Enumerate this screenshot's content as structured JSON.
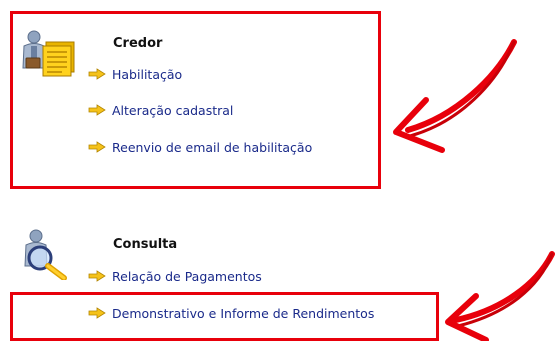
{
  "sections": [
    {
      "title": "Credor",
      "icon": "person-documents-icon",
      "links": [
        {
          "label": "Habilitação"
        },
        {
          "label": "Alteração cadastral"
        },
        {
          "label": "Reenvio de email de habilitação"
        }
      ]
    },
    {
      "title": "Consulta",
      "icon": "person-magnifier-icon",
      "links": [
        {
          "label": "Relação de Pagamentos"
        },
        {
          "label": "Demonstrativo e Informe de Rendimentos"
        }
      ]
    }
  ],
  "annotation": {
    "highlight_color": "#e8000b",
    "arrow_icon": "red-hand-drawn-arrow-icon",
    "link_color": "#1a2a8a",
    "bullet_icon": "yellow-arrow-icon"
  }
}
